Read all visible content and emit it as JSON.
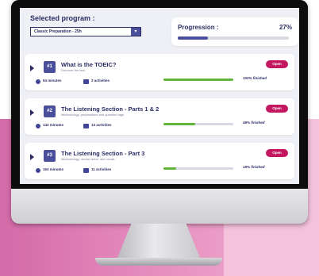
{
  "selection": {
    "title": "Selected program :",
    "program_value": "Classic Preparation - 25h",
    "dropdown_icon": "chevron-down-icon"
  },
  "progression": {
    "title": "Progression :",
    "percent": "27%",
    "fraction": 0.27
  },
  "courses": [
    {
      "number": "#1",
      "title": "What is the TOEIC?",
      "subtitle": "Discover the test.",
      "duration": "64 minutes",
      "activities": "2 activities",
      "finished": "100% finished",
      "progress": 1.0,
      "open_label": "Open"
    },
    {
      "number": "#2",
      "title": "The Listening Section - Parts 1 & 2",
      "subtitle": "Methodology, prepositions and question tags",
      "duration": "143 minutes",
      "activities": "13 activities",
      "finished": "46% finished",
      "progress": 0.46,
      "open_label": "Open"
    },
    {
      "number": "#3",
      "title": "The Listening Section - Part 3",
      "subtitle": "Methodology, modal verbs, and vocab.",
      "duration": "153 minutes",
      "activities": "11 activities",
      "finished": "18% finished",
      "progress": 0.18,
      "open_label": "Open"
    }
  ],
  "colors": {
    "primary": "#2b2d63",
    "accent": "#c3185f",
    "progress_green": "#63b43b",
    "number_badge": "#4a4f9b",
    "background_pink": "#d36aa9"
  }
}
